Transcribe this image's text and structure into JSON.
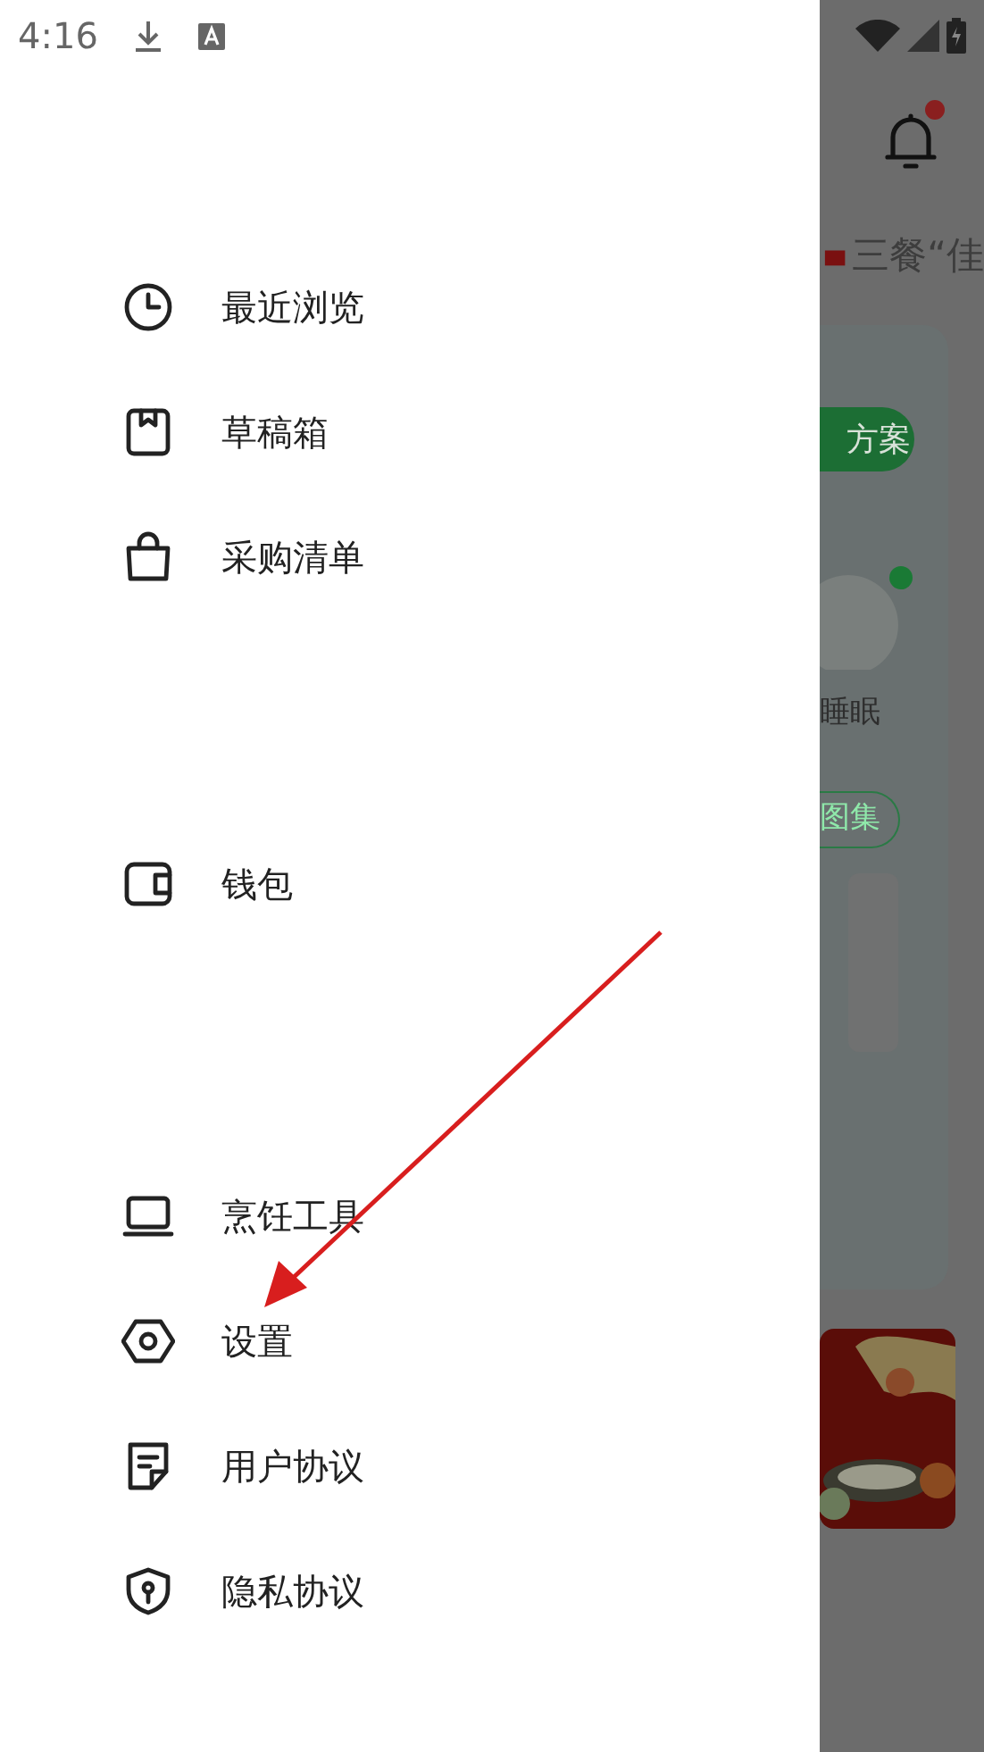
{
  "status_bar": {
    "time": "4:16"
  },
  "drawer": {
    "groups": [
      {
        "items": [
          {
            "label": "最近浏览"
          },
          {
            "label": "草稿箱"
          },
          {
            "label": "采购清单"
          }
        ]
      },
      {
        "items": [
          {
            "label": "钱包"
          }
        ]
      },
      {
        "items": [
          {
            "label": "烹饪工具"
          },
          {
            "label": "设置"
          },
          {
            "label": "用户协议"
          },
          {
            "label": "隐私协议"
          }
        ]
      }
    ]
  },
  "background": {
    "has_unread": true,
    "headline": "三餐“佳",
    "plan_button": "方案",
    "sleep_label": "睡眠",
    "gallery_button": "图集"
  }
}
